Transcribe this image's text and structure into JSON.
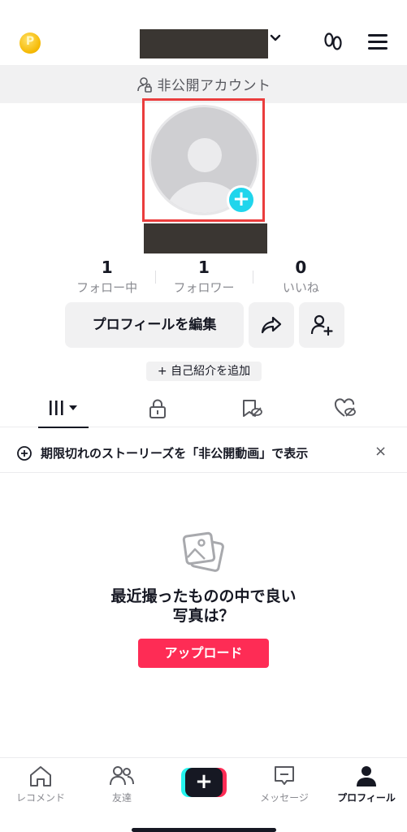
{
  "header": {
    "coin_symbol": "P",
    "private_label": "非公開アカウント"
  },
  "profile": {
    "add_photo_symbol": "+",
    "stats": [
      {
        "value": "1",
        "label": "フォロー中"
      },
      {
        "value": "1",
        "label": "フォロワー"
      },
      {
        "value": "0",
        "label": "いいね"
      }
    ],
    "edit_label": "プロフィールを編集",
    "bio_label": "+ 自己紹介を追加"
  },
  "notice": {
    "text": "期限切れのストーリーズを「非公開動画」で表示",
    "close": "×"
  },
  "empty_state": {
    "title_line1": "最近撮ったものの中で良い",
    "title_line2": "写真は？",
    "upload_label": "アップロード"
  },
  "bottom_nav": {
    "items": [
      {
        "label": "レコメンド",
        "icon": "home-icon"
      },
      {
        "label": "友達",
        "icon": "friends-icon"
      },
      {
        "label": "+",
        "icon": "create-icon"
      },
      {
        "label": "メッセージ",
        "icon": "inbox-icon"
      },
      {
        "label": "プロフィール",
        "icon": "profile-icon"
      }
    ]
  },
  "colors": {
    "accent": "#fe2c55",
    "cyan": "#20d5ec",
    "highlight_box": "#ea3d3d"
  }
}
